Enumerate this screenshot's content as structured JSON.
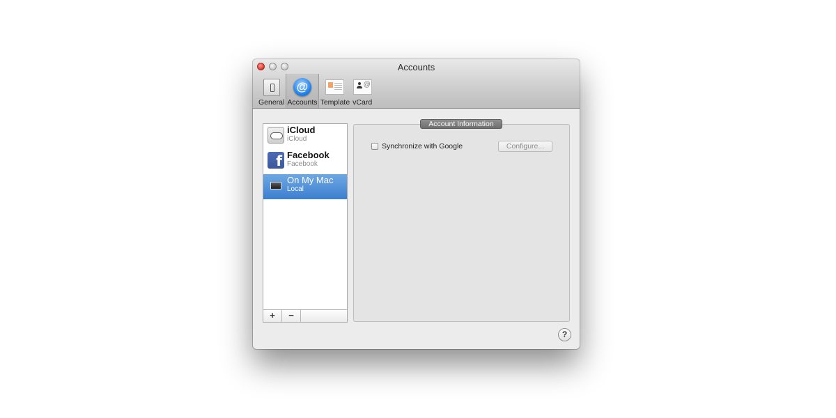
{
  "window": {
    "title": "Accounts"
  },
  "toolbar": {
    "tabs": [
      {
        "label": "General",
        "icon": "general-icon"
      },
      {
        "label": "Accounts",
        "icon": "accounts-icon",
        "active": true
      },
      {
        "label": "Template",
        "icon": "template-icon"
      },
      {
        "label": "vCard",
        "icon": "vcard-icon"
      }
    ]
  },
  "accounts": {
    "items": [
      {
        "name": "iCloud",
        "sub": "iCloud",
        "icon": "icloud-icon"
      },
      {
        "name": "Facebook",
        "sub": "Facebook",
        "icon": "facebook-icon"
      },
      {
        "name": "On My Mac",
        "sub": "Local",
        "icon": "mac-icon",
        "selected": true
      }
    ],
    "add_label": "+",
    "remove_label": "−"
  },
  "panel": {
    "section_title": "Account Information",
    "sync_label": "Synchronize with Google",
    "sync_checked": false,
    "configure_label": "Configure..."
  },
  "help": {
    "label": "?"
  },
  "colors": {
    "selection": "#3d7fd0",
    "facebook": "#3b5998",
    "accent": "#1f7fe8"
  }
}
